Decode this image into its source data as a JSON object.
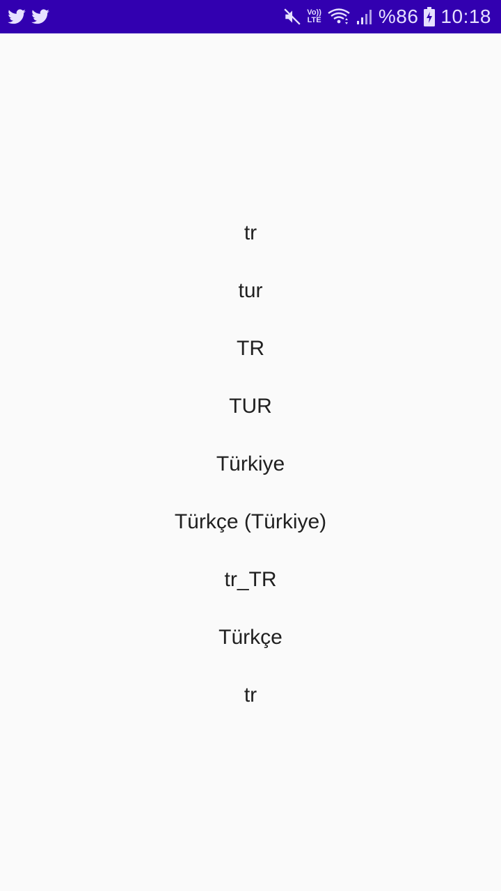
{
  "status_bar": {
    "notification_icons": [
      "twitter-icon",
      "twitter-icon"
    ],
    "mute_icon": "mute-icon",
    "volte_line1": "Vo))",
    "volte_line2": "LTE",
    "wifi_icon": "wifi-icon",
    "signal_icon": "signal-icon",
    "battery_percent": "%86",
    "battery_icon": "battery-charging-icon",
    "time": "10:18",
    "background_color": "#3200b0"
  },
  "locale_values": [
    "tr",
    "tur",
    "TR",
    "TUR",
    "Türkiye",
    "Türkçe (Türkiye)",
    "tr_TR",
    "Türkçe",
    "tr"
  ]
}
